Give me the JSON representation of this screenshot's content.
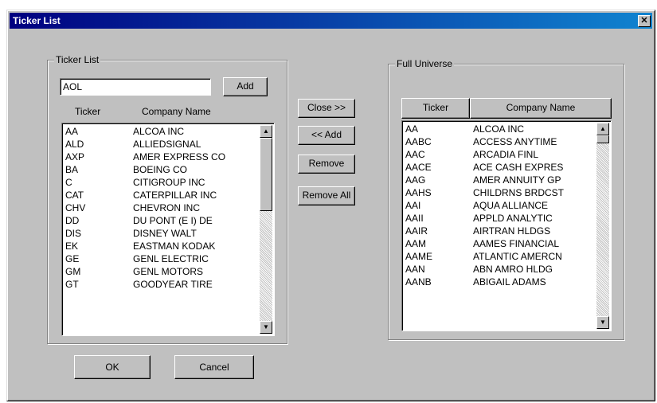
{
  "window": {
    "title": "Ticker List",
    "close_glyph": "✕"
  },
  "left_group": {
    "legend": "Ticker List",
    "input_value": "AOL",
    "add_label": "Add",
    "col_ticker": "Ticker",
    "col_company": "Company Name",
    "rows": [
      {
        "ticker": "AA",
        "company": "ALCOA INC"
      },
      {
        "ticker": "ALD",
        "company": "ALLIEDSIGNAL"
      },
      {
        "ticker": "AXP",
        "company": "AMER EXPRESS CO"
      },
      {
        "ticker": "BA",
        "company": "BOEING CO"
      },
      {
        "ticker": "C",
        "company": "CITIGROUP INC"
      },
      {
        "ticker": "CAT",
        "company": "CATERPILLAR INC"
      },
      {
        "ticker": "CHV",
        "company": "CHEVRON INC"
      },
      {
        "ticker": "DD",
        "company": "DU PONT (E I) DE"
      },
      {
        "ticker": "DIS",
        "company": "DISNEY WALT"
      },
      {
        "ticker": "EK",
        "company": "EASTMAN KODAK"
      },
      {
        "ticker": "GE",
        "company": "GENL ELECTRIC"
      },
      {
        "ticker": "GM",
        "company": "GENL MOTORS"
      },
      {
        "ticker": "GT",
        "company": "GOODYEAR TIRE"
      }
    ]
  },
  "middle": {
    "close_label": "Close >>",
    "add_label": "<< Add",
    "remove_label": "Remove",
    "remove_all_label": "Remove All"
  },
  "right_group": {
    "legend": "Full Universe",
    "col_ticker": "Ticker",
    "col_company": "Company Name",
    "rows": [
      {
        "ticker": "AA",
        "company": "ALCOA INC"
      },
      {
        "ticker": "AABC",
        "company": "ACCESS ANYTIME"
      },
      {
        "ticker": "AAC",
        "company": "ARCADIA FINL"
      },
      {
        "ticker": "AACE",
        "company": "ACE CASH EXPRES"
      },
      {
        "ticker": "AAG",
        "company": "AMER ANNUITY GP"
      },
      {
        "ticker": "AAHS",
        "company": "CHILDRNS BRDCST"
      },
      {
        "ticker": "AAI",
        "company": "AQUA ALLIANCE"
      },
      {
        "ticker": "AAII",
        "company": "APPLD ANALYTIC"
      },
      {
        "ticker": "AAIR",
        "company": "AIRTRAN HLDGS"
      },
      {
        "ticker": "AAM",
        "company": "AAMES FINANCIAL"
      },
      {
        "ticker": "AAME",
        "company": "ATLANTIC AMERCN"
      },
      {
        "ticker": "AAN",
        "company": "ABN AMRO HLDG"
      },
      {
        "ticker": "AANB",
        "company": "ABIGAIL ADAMS"
      }
    ]
  },
  "footer": {
    "ok_label": "OK",
    "cancel_label": "Cancel"
  },
  "scroll_glyphs": {
    "up": "▲",
    "down": "▼"
  }
}
